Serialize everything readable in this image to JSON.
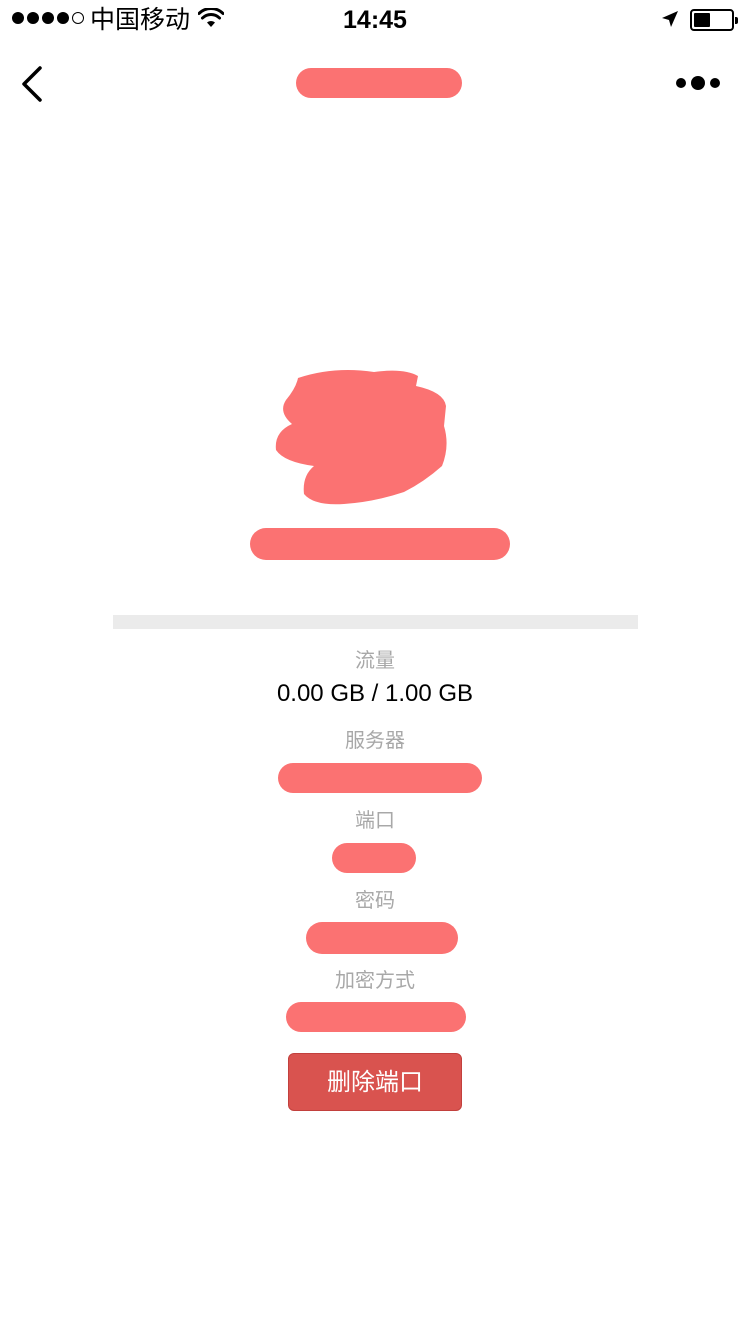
{
  "status_bar": {
    "carrier": "中国移动",
    "time": "14:45",
    "signal_strength": 4,
    "battery_level": 0.35
  },
  "nav": {
    "title": ""
  },
  "info": {
    "traffic_label": "流量",
    "traffic_value": "0.00 GB / 1.00 GB",
    "server_label": "服务器",
    "port_label": "端口",
    "password_label": "密码",
    "encryption_label": "加密方式"
  },
  "actions": {
    "delete_label": "删除端口"
  },
  "colors": {
    "redaction": "#fb7272",
    "button": "#d9534f",
    "label": "#a8a8a8"
  }
}
